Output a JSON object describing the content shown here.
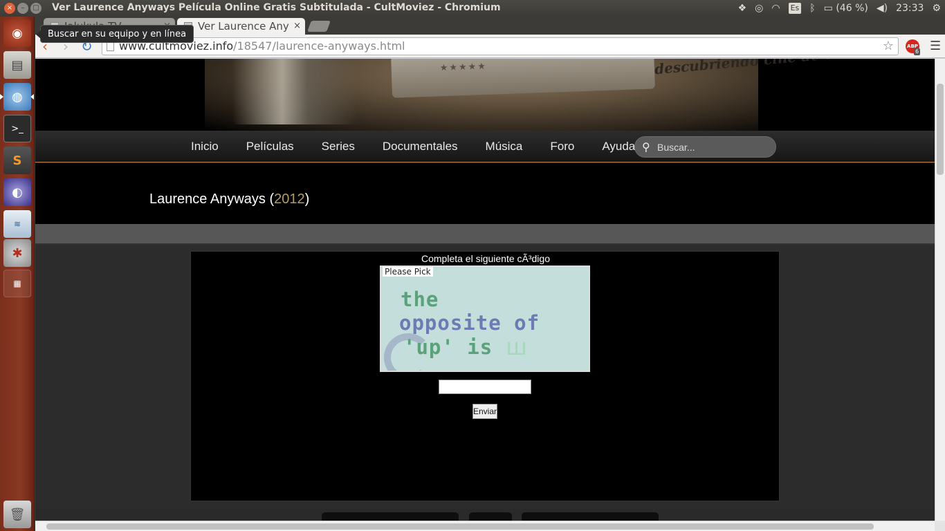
{
  "window": {
    "title": "Ver Laurence Anyways Película Online Gratis Subtitulada - CultMoviez - Chromium",
    "close_glyph": "×",
    "min_glyph": "–",
    "max_glyph": "□"
  },
  "panel": {
    "keyboard_layout": "Es",
    "battery": "(46 %)",
    "clock": "23:33",
    "icons": [
      "dropbox-icon",
      "sync-icon",
      "wifi-icon",
      "keyboard-icon",
      "bluetooth-icon",
      "battery-icon",
      "volume-icon",
      "settings-icon"
    ]
  },
  "launcher": {
    "tooltip": "Buscar en su equipo y en línea",
    "items": [
      "dash-icon",
      "files-icon",
      "chromium-icon",
      "terminal-icon",
      "sublime-text-icon",
      "eclipse-icon",
      "mysql-workbench-icon",
      "system-settings-icon",
      "workspace-switcher-icon",
      "trash-icon"
    ]
  },
  "browser": {
    "tabs": [
      {
        "label": "Jalukula TV",
        "active": false
      },
      {
        "label": "Ver Laurence Any",
        "active": true
      }
    ],
    "tab_close_glyph": "×",
    "url_host": "www.cultmoviez.info",
    "url_path": "/18547/laurence-anyways.html",
    "abp_label": "ABP",
    "abp_count": "6"
  },
  "site": {
    "tagline": "descubriendo cine de culto",
    "stars": "★★★★★",
    "nav": [
      "Inicio",
      "Películas",
      "Series",
      "Documentales",
      "Música",
      "Foro",
      "Ayuda"
    ],
    "search_placeholder": "Buscar...",
    "movie_title": "Laurence Anyways",
    "movie_year": "2012",
    "captcha": {
      "prompt": "Completa el siguiente cÃ³digo",
      "label": "Please Pick",
      "lines": [
        "the",
        "opposite of",
        "'up' is"
      ],
      "submit_label": "Enviar"
    }
  },
  "colors": {
    "launcher": "#8a3a24",
    "year": "#b89a6a",
    "navbar_border": "#b57a46",
    "captcha_bg": "#c4dfdb"
  }
}
